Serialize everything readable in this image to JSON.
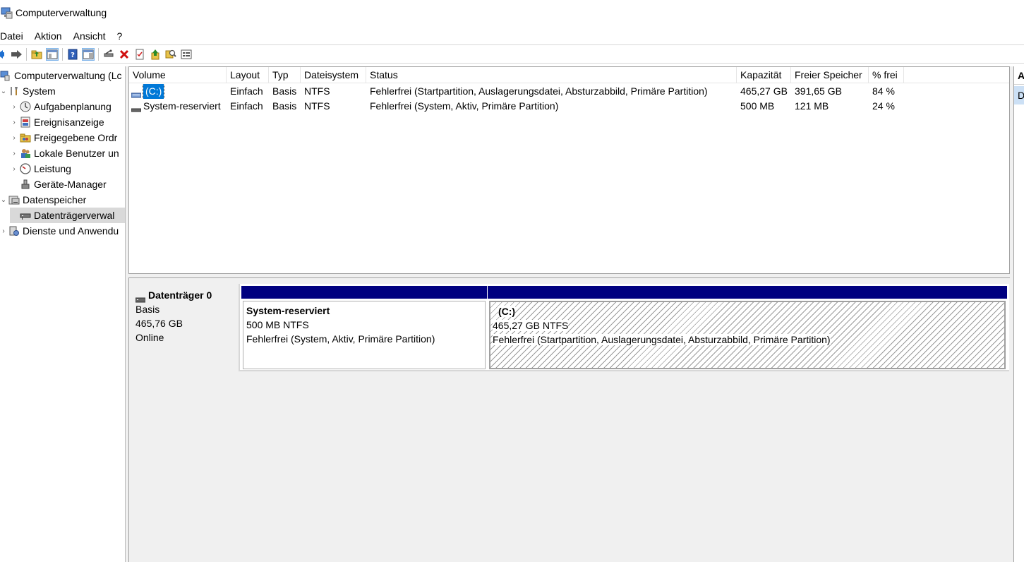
{
  "window": {
    "title": "Computerverwaltung"
  },
  "menu": {
    "items": [
      "Datei",
      "Aktion",
      "Ansicht",
      "?"
    ]
  },
  "toolbar": {
    "icons": [
      "back-arrow-icon",
      "forward-arrow-icon",
      "folder-up-icon",
      "show-hide-tree-icon",
      "help-icon",
      "properties-pane-icon",
      "connect-drive-icon",
      "delete-icon",
      "properties-icon",
      "up-level-icon",
      "search-icon",
      "settings-icon"
    ]
  },
  "tree": {
    "items": [
      {
        "label": "Computerverwaltung (Lc",
        "arrow": "",
        "level": 0
      },
      {
        "label": "System",
        "arrow": "⌄",
        "level": 1
      },
      {
        "label": "Aufgabenplanung",
        "arrow": "›",
        "level": 2
      },
      {
        "label": "Ereignisanzeige",
        "arrow": "›",
        "level": 2
      },
      {
        "label": "Freigegebene Ordr",
        "arrow": "›",
        "level": 2
      },
      {
        "label": "Lokale Benutzer un",
        "arrow": "›",
        "level": 2
      },
      {
        "label": "Leistung",
        "arrow": "›",
        "level": 2
      },
      {
        "label": "Geräte-Manager",
        "arrow": "",
        "level": 2
      },
      {
        "label": "Datenspeicher",
        "arrow": "⌄",
        "level": 1
      },
      {
        "label": "Datenträgerverwal",
        "arrow": "",
        "level": 2
      },
      {
        "label": "Dienste und Anwendu",
        "arrow": "›",
        "level": 1
      }
    ]
  },
  "volumes": {
    "columns": [
      "Volume",
      "Layout",
      "Typ",
      "Dateisystem",
      "Status",
      "Kapazität",
      "Freier Speicher",
      "% frei"
    ],
    "rows": [
      {
        "volume": "(C:)",
        "layout": "Einfach",
        "typ": "Basis",
        "dateisystem": "NTFS",
        "status": "Fehlerfrei (Startpartition, Auslagerungsdatei, Absturzabbild, Primäre Partition)",
        "kapazitaet": "465,27 GB",
        "frei": "391,65 GB",
        "prozent": "84 %"
      },
      {
        "volume": "System-reserviert",
        "layout": "Einfach",
        "typ": "Basis",
        "dateisystem": "NTFS",
        "status": "Fehlerfrei (System, Aktiv, Primäre Partition)",
        "kapazitaet": "500 MB",
        "frei": "121 MB",
        "prozent": "24 %"
      }
    ]
  },
  "disk": {
    "name": "Datenträger 0",
    "type": "Basis",
    "size": "465,76 GB",
    "state": "Online",
    "partitions": [
      {
        "name": "System-reserviert",
        "size": "500 MB NTFS",
        "status": "Fehlerfrei (System, Aktiv, Primäre Partition)"
      },
      {
        "name": "(C:)",
        "size": "465,27 GB NTFS",
        "status": "Fehlerfrei (Startpartition, Auslagerungsdatei, Absturzabbild, Primäre Partition)"
      }
    ]
  },
  "actions": {
    "header": "A",
    "item": "D"
  },
  "colors": {
    "partition_bar": "#000080",
    "selection": "#0078d7",
    "action_selected": "#cce0f5"
  }
}
